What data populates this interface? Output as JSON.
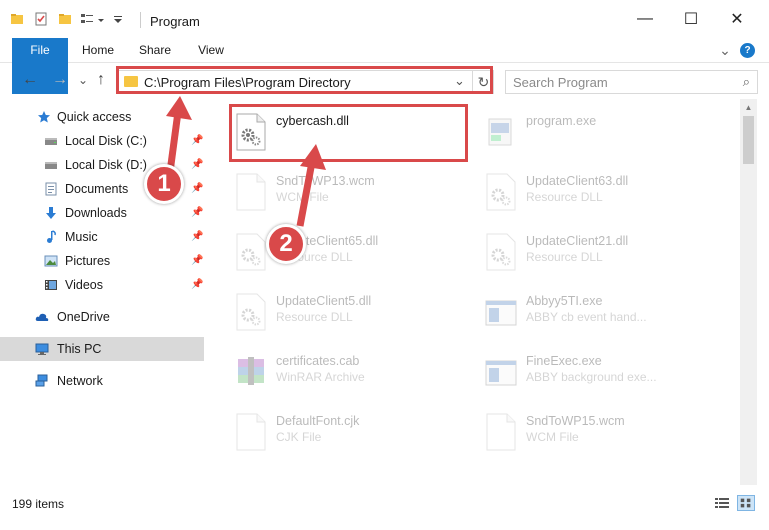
{
  "window": {
    "title": "Program",
    "minimize_label": "—",
    "maximize_label": "☐",
    "close_label": "✕"
  },
  "ribbon": {
    "tabs": [
      "File",
      "Home",
      "Share",
      "View"
    ],
    "collapse_label": "⌄",
    "help_label": "?"
  },
  "nav": {
    "back_label": "←",
    "forward_label": "→",
    "history_label": "⌄",
    "up_label": "↑"
  },
  "address": {
    "path": "C:\\Program Files\\Program Directory",
    "dropdown_label": "⌄",
    "refresh_label": "↻"
  },
  "search": {
    "placeholder": "Search Program",
    "icon_label": "⌕"
  },
  "sidebar": {
    "items": [
      {
        "label": "Quick access",
        "icon": "star-icon",
        "pinned": false
      },
      {
        "label": "Local Disk (C:)",
        "icon": "drive-icon",
        "pinned": true
      },
      {
        "label": "Local Disk (D:)",
        "icon": "drive-icon",
        "pinned": true
      },
      {
        "label": "Documents",
        "icon": "documents-icon",
        "pinned": true
      },
      {
        "label": "Downloads",
        "icon": "download-icon",
        "pinned": true
      },
      {
        "label": "Music",
        "icon": "music-icon",
        "pinned": true
      },
      {
        "label": "Pictures",
        "icon": "pictures-icon",
        "pinned": true
      },
      {
        "label": "Videos",
        "icon": "videos-icon",
        "pinned": true
      },
      {
        "label": "OneDrive",
        "icon": "cloud-icon",
        "pinned": false
      },
      {
        "label": "This PC",
        "icon": "computer-icon",
        "pinned": false
      },
      {
        "label": "Network",
        "icon": "network-icon",
        "pinned": false
      }
    ],
    "pin_glyph": "📌"
  },
  "files": [
    {
      "name": "cybercash.dll",
      "type": "",
      "icon": "dll-gear-icon"
    },
    {
      "name": "program.exe",
      "type": "",
      "icon": "exe-icon"
    },
    {
      "name": "SndToWP13.wcm",
      "type": "WCM File",
      "icon": "blank-file-icon"
    },
    {
      "name": "UpdateClient63.dll",
      "type": "Resource DLL",
      "icon": "dll-gear-icon"
    },
    {
      "name": "UpdateClient65.dll",
      "type": "Resource DLL",
      "icon": "dll-gear-icon"
    },
    {
      "name": "UpdateClient21.dll",
      "type": "Resource DLL",
      "icon": "dll-gear-icon"
    },
    {
      "name": "UpdateClient5.dll",
      "type": "Resource DLL",
      "icon": "dll-gear-icon"
    },
    {
      "name": "Abbyy5TI.exe",
      "type": "ABBY cb event hand...",
      "icon": "app-window-icon"
    },
    {
      "name": "certificates.cab",
      "type": "WinRAR Archive",
      "icon": "winrar-icon"
    },
    {
      "name": "FineExec.exe",
      "type": "ABBY background exe...",
      "icon": "app-window-icon"
    },
    {
      "name": "DefaultFont.cjk",
      "type": "CJK File",
      "icon": "blank-file-icon"
    },
    {
      "name": "SndToWP15.wcm",
      "type": "WCM File",
      "icon": "blank-file-icon"
    }
  ],
  "status": {
    "count": "199 items"
  },
  "annotations": {
    "step1": "1",
    "step2": "2",
    "color": "#d9494a"
  },
  "colors": {
    "accent": "#1979ca",
    "folder": "#f6c542",
    "selected_nav": "#d9d9d9"
  }
}
